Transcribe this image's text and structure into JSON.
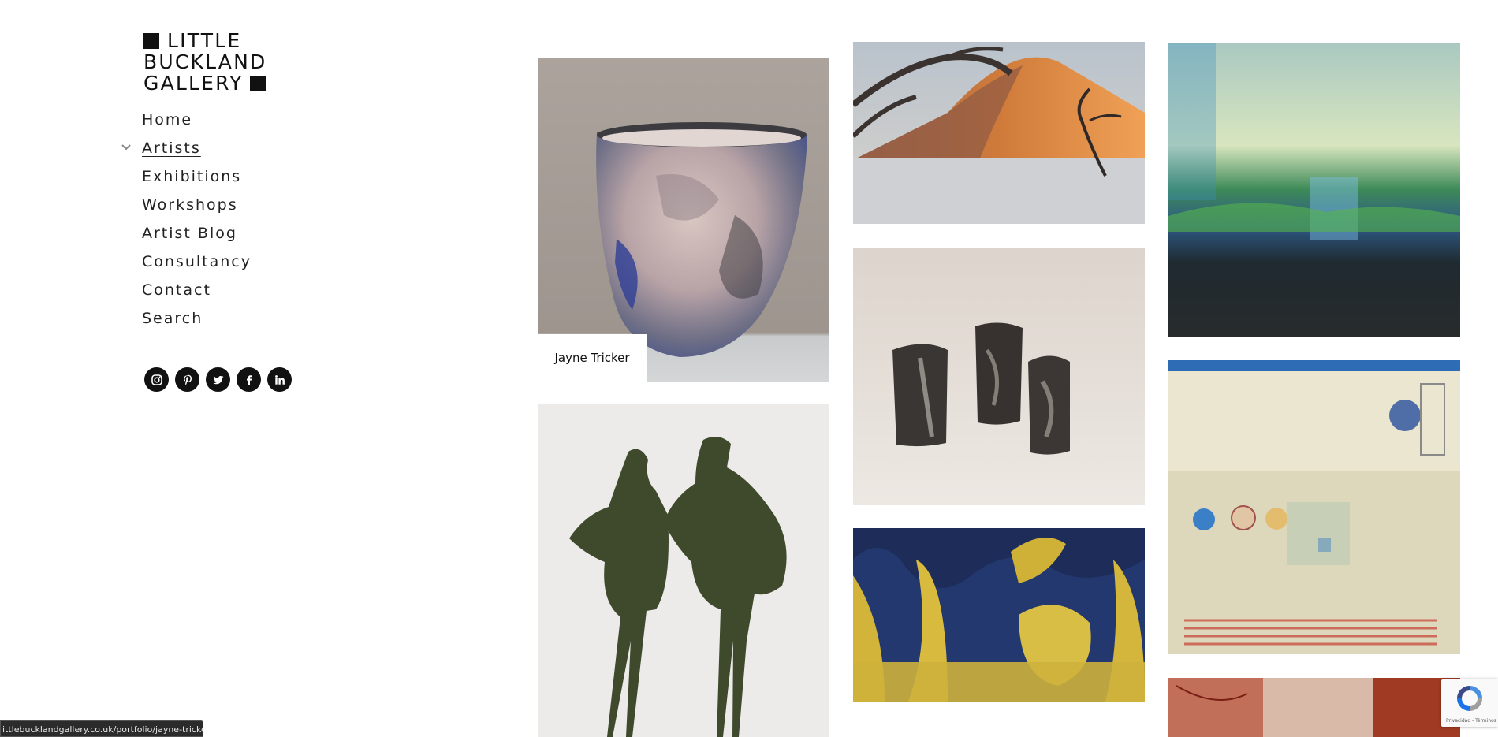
{
  "logo": {
    "line1": "LITTLE",
    "line2": "BUCKLAND",
    "line3": "GALLERY"
  },
  "nav": {
    "items": [
      {
        "label": "Home"
      },
      {
        "label": "Artists",
        "active": true
      },
      {
        "label": "Exhibitions"
      },
      {
        "label": "Workshops"
      },
      {
        "label": "Artist Blog"
      },
      {
        "label": "Consultancy"
      },
      {
        "label": "Contact"
      },
      {
        "label": "Search"
      }
    ]
  },
  "social": [
    "instagram-icon",
    "pinterest-icon",
    "twitter-icon",
    "facebook-icon",
    "linkedin-icon"
  ],
  "gallery": {
    "hover_caption": "Jayne Tricker"
  },
  "status_bar": {
    "url": "ittlebucklandgallery.co.uk/portfolio/jayne-tricker"
  },
  "recaptcha": {
    "footer": "Privacidad - Términos"
  },
  "colors": {
    "text": "#222222",
    "icon_bg": "#111111",
    "background": "#ffffff"
  }
}
